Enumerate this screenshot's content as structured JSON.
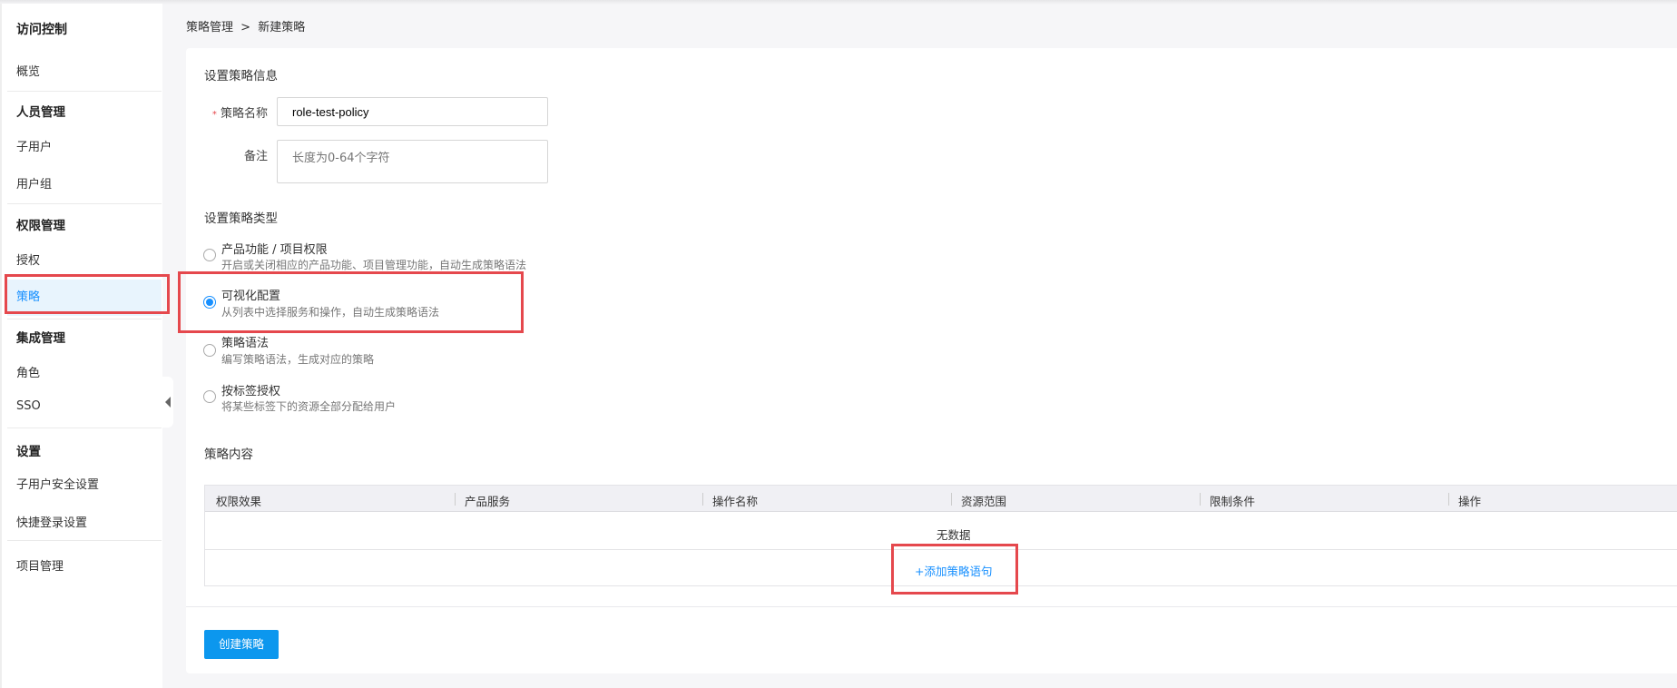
{
  "breadcrumb": {
    "parent": "策略管理",
    "separator": ">",
    "current": "新建策略"
  },
  "sidebar": {
    "title": "访问控制",
    "overview": "概览",
    "groups": [
      {
        "label": "人员管理",
        "items": [
          "子用户",
          "用户组"
        ]
      },
      {
        "label": "权限管理",
        "items": [
          "授权",
          "策略"
        ]
      },
      {
        "label": "集成管理",
        "items": [
          "角色",
          "SSO"
        ]
      },
      {
        "label": "设置",
        "items": [
          "子用户安全设置",
          "快捷登录设置"
        ]
      }
    ],
    "project": "项目管理",
    "active": "策略"
  },
  "form": {
    "info_title": "设置策略信息",
    "name_required": "*",
    "name_label": "策略名称",
    "name_value": "role-test-policy",
    "remark_label": "备注",
    "remark_placeholder": "长度为0-64个字符",
    "type_title": "设置策略类型",
    "types": [
      {
        "title": "产品功能 / 项目权限",
        "desc": "开启或关闭相应的产品功能、项目管理功能，自动生成策略语法",
        "selected": false
      },
      {
        "title": "可视化配置",
        "desc": "从列表中选择服务和操作，自动生成策略语法",
        "selected": true
      },
      {
        "title": "策略语法",
        "desc": "编写策略语法，生成对应的策略",
        "selected": false
      },
      {
        "title": "按标签授权",
        "desc": "将某些标签下的资源全部分配给用户",
        "selected": false
      }
    ],
    "content_title": "策略内容",
    "columns": [
      "权限效果",
      "产品服务",
      "操作名称",
      "资源范围",
      "限制条件",
      "操作"
    ],
    "empty": "无数据",
    "add_statement": "+添加策略语句",
    "submit": "创建策略"
  },
  "colors": {
    "accent": "#1890ff",
    "button": "#0c97ee",
    "highlight": "#e5484d"
  }
}
